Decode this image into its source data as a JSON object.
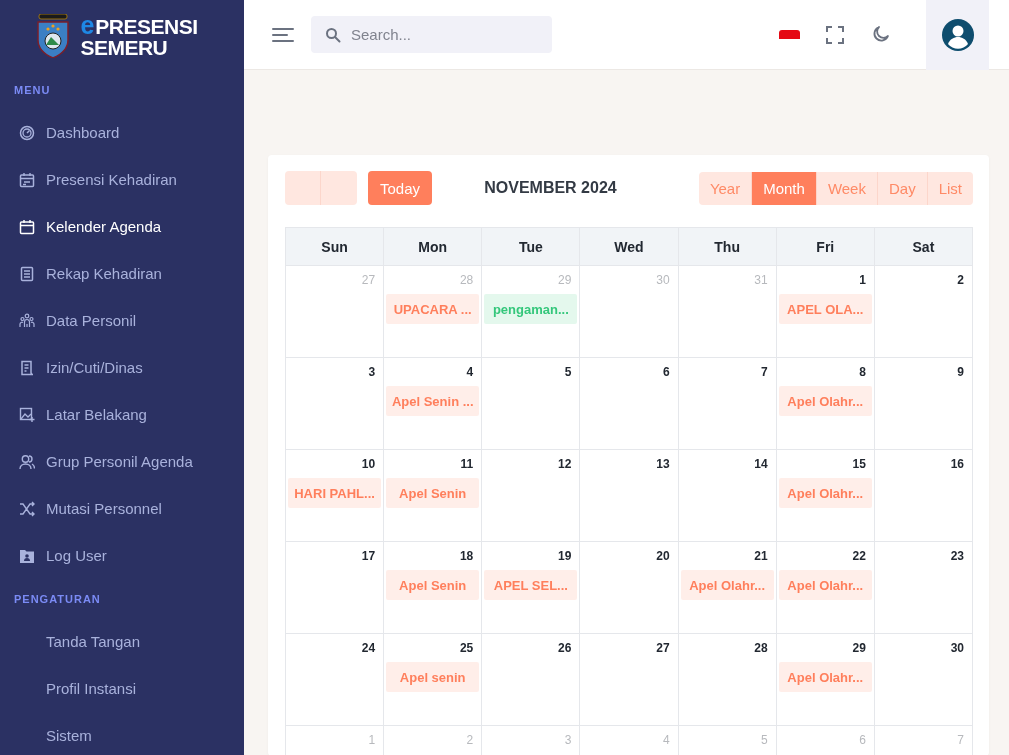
{
  "logo": {
    "mark": "e",
    "line1": "PRESENSI",
    "line2": "SEMERU"
  },
  "sidebar": {
    "sections": [
      {
        "title": "MENU",
        "items": [
          {
            "label": "Dashboard",
            "selected": false
          },
          {
            "label": "Presensi Kehadiran",
            "selected": false
          },
          {
            "label": "Kelender Agenda",
            "selected": true
          },
          {
            "label": "Rekap Kehadiran",
            "selected": false
          },
          {
            "label": "Data Personil",
            "selected": false
          },
          {
            "label": "Izin/Cuti/Dinas",
            "selected": false
          },
          {
            "label": "Latar Belakang",
            "selected": false
          },
          {
            "label": "Grup Personil Agenda",
            "selected": false
          },
          {
            "label": "Mutasi Personnel",
            "selected": false
          },
          {
            "label": "Log User",
            "selected": false
          }
        ]
      },
      {
        "title": "PENGATURAN",
        "items": [
          {
            "label": "Tanda Tangan",
            "selected": false
          },
          {
            "label": "Profil Instansi",
            "selected": false
          },
          {
            "label": "Sistem",
            "selected": false
          }
        ]
      }
    ]
  },
  "search": {
    "placeholder": "Search..."
  },
  "calendar": {
    "today_button": "Today",
    "title": "NOVEMBER 2024",
    "views": [
      {
        "label": "Year",
        "selected": false
      },
      {
        "label": "Month",
        "selected": true
      },
      {
        "label": "Week",
        "selected": false
      },
      {
        "label": "Day",
        "selected": false
      },
      {
        "label": "List",
        "selected": false
      }
    ],
    "weekdays": [
      "Sun",
      "Mon",
      "Tue",
      "Wed",
      "Thu",
      "Fri",
      "Sat"
    ],
    "weeks": [
      [
        {
          "day": "27",
          "other_month": true
        },
        {
          "day": "28",
          "other_month": true,
          "events": [
            {
              "title": "UPACARA ...",
              "color": "#ff7f5c"
            }
          ]
        },
        {
          "day": "29",
          "other_month": true,
          "events": [
            {
              "title": "pengaman...",
              "color": "#34c77b"
            }
          ]
        },
        {
          "day": "30",
          "other_month": true
        },
        {
          "day": "31",
          "other_month": true
        },
        {
          "day": "1",
          "other_month": false,
          "events": [
            {
              "title": "APEL OLA...",
              "color": "#ff7f5c"
            }
          ]
        },
        {
          "day": "2",
          "other_month": false
        }
      ],
      [
        {
          "day": "3",
          "other_month": false
        },
        {
          "day": "4",
          "other_month": false,
          "events": [
            {
              "title": "Apel Senin ...",
              "color": "#ff7f5c"
            }
          ]
        },
        {
          "day": "5",
          "other_month": false
        },
        {
          "day": "6",
          "other_month": false
        },
        {
          "day": "7",
          "other_month": false
        },
        {
          "day": "8",
          "other_month": false,
          "events": [
            {
              "title": "Apel Olahr...",
              "color": "#ff7f5c"
            }
          ]
        },
        {
          "day": "9",
          "other_month": false
        }
      ],
      [
        {
          "day": "10",
          "other_month": false,
          "events": [
            {
              "title": "HARI PAHL...",
              "color": "#ff7f5c"
            }
          ]
        },
        {
          "day": "11",
          "other_month": false,
          "events": [
            {
              "title": "Apel Senin",
              "color": "#ff7f5c"
            }
          ]
        },
        {
          "day": "12",
          "other_month": false
        },
        {
          "day": "13",
          "other_month": false
        },
        {
          "day": "14",
          "other_month": false
        },
        {
          "day": "15",
          "other_month": false,
          "events": [
            {
              "title": "Apel Olahr...",
              "color": "#ff7f5c"
            }
          ]
        },
        {
          "day": "16",
          "other_month": false
        }
      ],
      [
        {
          "day": "17",
          "other_month": false
        },
        {
          "day": "18",
          "other_month": false,
          "events": [
            {
              "title": "Apel Senin",
              "color": "#ff7f5c"
            }
          ]
        },
        {
          "day": "19",
          "other_month": false,
          "events": [
            {
              "title": "APEL SEL...",
              "color": "#ff7f5c"
            }
          ]
        },
        {
          "day": "20",
          "other_month": false
        },
        {
          "day": "21",
          "other_month": false,
          "events": [
            {
              "title": "Apel Olahr...",
              "color": "#ff7f5c"
            }
          ]
        },
        {
          "day": "22",
          "other_month": false,
          "events": [
            {
              "title": "Apel Olahr...",
              "color": "#ff7f5c"
            }
          ]
        },
        {
          "day": "23",
          "other_month": false
        }
      ],
      [
        {
          "day": "24",
          "other_month": false
        },
        {
          "day": "25",
          "other_month": false,
          "events": [
            {
              "title": "Apel senin",
              "color": "#ff7f5c"
            }
          ]
        },
        {
          "day": "26",
          "other_month": false
        },
        {
          "day": "27",
          "other_month": false
        },
        {
          "day": "28",
          "other_month": false
        },
        {
          "day": "29",
          "other_month": false,
          "events": [
            {
              "title": "Apel Olahr...",
              "color": "#ff7f5c"
            }
          ]
        },
        {
          "day": "30",
          "other_month": false
        }
      ],
      [
        {
          "day": "1",
          "other_month": true
        },
        {
          "day": "2",
          "other_month": true
        },
        {
          "day": "3",
          "other_month": true
        },
        {
          "day": "4",
          "other_month": true
        },
        {
          "day": "5",
          "other_month": true
        },
        {
          "day": "6",
          "other_month": true
        },
        {
          "day": "7",
          "other_month": true
        }
      ]
    ]
  }
}
